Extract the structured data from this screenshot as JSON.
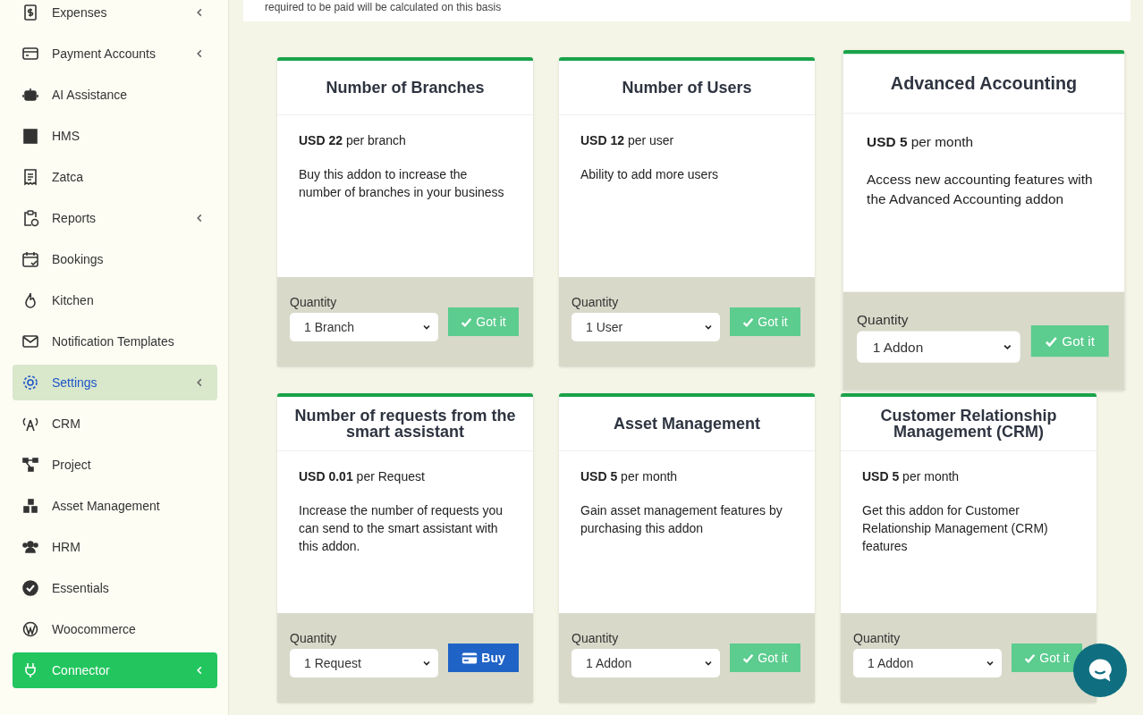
{
  "sidebar": {
    "items": [
      {
        "label": "Expenses",
        "expandable": true,
        "selected": false,
        "highlighted": false
      },
      {
        "label": "Payment Accounts",
        "expandable": true,
        "selected": false,
        "highlighted": false
      },
      {
        "label": "AI Assistance",
        "expandable": false,
        "selected": false,
        "highlighted": false
      },
      {
        "label": "HMS",
        "expandable": false,
        "selected": false,
        "highlighted": false
      },
      {
        "label": "Zatca",
        "expandable": false,
        "selected": false,
        "highlighted": false
      },
      {
        "label": "Reports",
        "expandable": true,
        "selected": false,
        "highlighted": false
      },
      {
        "label": "Bookings",
        "expandable": false,
        "selected": false,
        "highlighted": false
      },
      {
        "label": "Kitchen",
        "expandable": false,
        "selected": false,
        "highlighted": false
      },
      {
        "label": "Notification Templates",
        "expandable": false,
        "selected": false,
        "highlighted": false
      },
      {
        "label": "Settings",
        "expandable": true,
        "selected": true,
        "highlighted": false
      },
      {
        "label": "CRM",
        "expandable": false,
        "selected": false,
        "highlighted": false
      },
      {
        "label": "Project",
        "expandable": false,
        "selected": false,
        "highlighted": false
      },
      {
        "label": "Asset Management",
        "expandable": false,
        "selected": false,
        "highlighted": false
      },
      {
        "label": "HRM",
        "expandable": false,
        "selected": false,
        "highlighted": false
      },
      {
        "label": "Essentials",
        "expandable": false,
        "selected": false,
        "highlighted": false
      },
      {
        "label": "Woocommerce",
        "expandable": false,
        "selected": false,
        "highlighted": false
      },
      {
        "label": "Connector",
        "expandable": true,
        "selected": false,
        "highlighted": true
      }
    ]
  },
  "intro": "required to be paid will be calculated on this basis",
  "addons": [
    {
      "title": "Number of Branches",
      "price": "USD 22",
      "unit": "per branch",
      "description": "Buy this addon to increase the number of branches in your business",
      "quantity_label": "Quantity",
      "quantity": "1 Branch",
      "button": {
        "kind": "got_it",
        "label": "Got it"
      },
      "raised": false
    },
    {
      "title": "Number of Users",
      "price": "USD 12",
      "unit": "per user",
      "description": "Ability to add more users",
      "quantity_label": "Quantity",
      "quantity": "1 User",
      "button": {
        "kind": "got_it",
        "label": "Got it"
      },
      "raised": false
    },
    {
      "title": "Advanced Accounting",
      "price": "USD 5",
      "unit": "per month",
      "description": "Access new accounting features with the Advanced Accounting addon",
      "quantity_label": "Quantity",
      "quantity": "1 Addon",
      "button": {
        "kind": "got_it",
        "label": "Got it"
      },
      "raised": true
    },
    {
      "title": "Number of requests from the smart assistant",
      "price": "USD 0.01",
      "unit": "per Request",
      "description": "Increase the number of requests you can send to the smart assistant with this addon.",
      "quantity_label": "Quantity",
      "quantity": "1 Request",
      "button": {
        "kind": "buy",
        "label": "Buy"
      },
      "raised": false
    },
    {
      "title": "Asset Management",
      "price": "USD 5",
      "unit": "per month",
      "description": "Gain asset management features by purchasing this addon",
      "quantity_label": "Quantity",
      "quantity": "1 Addon",
      "button": {
        "kind": "got_it",
        "label": "Got it"
      },
      "raised": false
    },
    {
      "title": "Customer Relationship Management (CRM)",
      "price": "USD 5",
      "unit": "per month",
      "description": "Get this addon for Customer Relationship Management (CRM) features",
      "quantity_label": "Quantity",
      "quantity": "1 Addon",
      "button": {
        "kind": "got_it",
        "label": "Got it"
      },
      "raised": false
    }
  ]
}
